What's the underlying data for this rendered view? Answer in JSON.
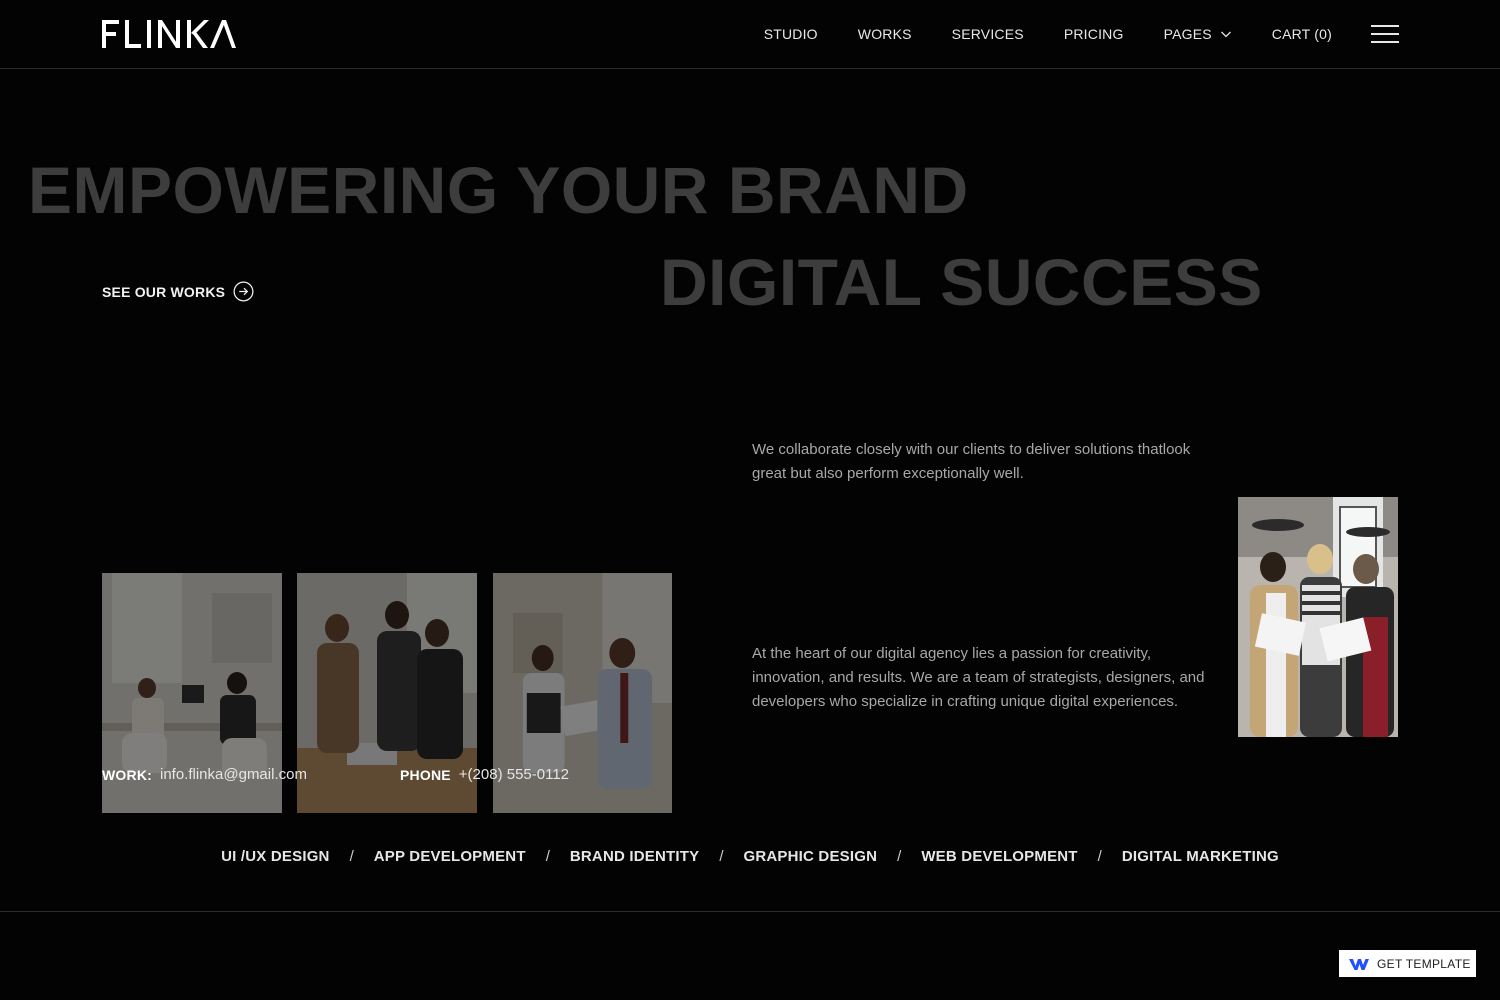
{
  "brand": {
    "logo_text": "FLINKA"
  },
  "nav": {
    "items": [
      {
        "label": "STUDIO"
      },
      {
        "label": "WORKS"
      },
      {
        "label": "SERVICES"
      },
      {
        "label": "PRICING"
      },
      {
        "label": "PAGES",
        "has_dropdown": true
      },
      {
        "label": "CART (0)"
      }
    ],
    "menu_icon": "hamburger-icon"
  },
  "hero": {
    "line1": "EMPOWERING YOUR BRAND",
    "line2": "DIGITAL SUCCESS",
    "cta_label": "SEE OUR WORKS",
    "cta_icon": "arrow-right-circle-icon"
  },
  "about": {
    "paragraph1": "We collaborate closely with our clients to deliver solutions thatlook great but also perform exceptionally well.",
    "paragraph2": "At the heart of our digital agency lies a passion for creativity, innovation, and results. We are a team of strategists, designers, and developers who specialize in crafting unique digital experiences."
  },
  "contact": {
    "work_label": "WORK:",
    "work_value": "info.flinka@gmail.com",
    "phone_label": "PHONE",
    "phone_value": "+(208) 555-0112"
  },
  "services": {
    "items": [
      "UI /UX DESIGN",
      "APP DEVELOPMENT",
      "BRAND IDENTITY",
      "GRAPHIC DESIGN",
      "WEB DEVELOPMENT",
      "DIGITAL MARKETING"
    ],
    "separator": "/"
  },
  "badge": {
    "label": "GET TEMPLATE",
    "icon": "webflow-icon"
  },
  "colors": {
    "background": "#030303",
    "headline": "#3d3d3d",
    "text": "#ffffff",
    "muted": "#a8a8a8"
  }
}
